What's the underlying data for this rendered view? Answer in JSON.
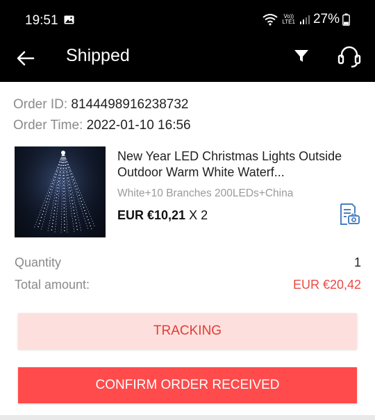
{
  "status_bar": {
    "time": "19:51",
    "network_label_top": "Vo))",
    "network_label_bottom": "LTE1",
    "battery": "27%",
    "icons": [
      "image-icon",
      "wifi-icon",
      "signal-icon",
      "battery-icon"
    ]
  },
  "app_bar": {
    "title": "Shipped",
    "icons": [
      "back-arrow-icon",
      "filter-icon",
      "headset-icon"
    ]
  },
  "order": {
    "id_label": "Order ID:",
    "id_value": "8144498916238732",
    "time_label": "Order Time:",
    "time_value": "2022-01-10 16:56"
  },
  "product": {
    "title": "New Year LED Christmas Lights Outside Outdoor  Warm White Waterf...",
    "variant": "White+10 Branches 200LEDs+China",
    "price": "EUR €10,21",
    "multiplier": "X 2",
    "thumbnail_icon": "christmas-lights-image",
    "action_icon": "receipt-camera-icon"
  },
  "summary": {
    "quantity_label": "Quantity",
    "quantity_value": "1",
    "total_label": "Total amount:",
    "total_value": "EUR €20,42"
  },
  "actions": {
    "tracking_label": "TRACKING",
    "confirm_label": "CONFIRM ORDER RECEIVED"
  },
  "colors": {
    "accent_red": "#ff4b4b",
    "tracking_bg": "#fde0dd",
    "price_red": "#e94a45",
    "receipt_icon_blue": "#4a7fc1"
  }
}
